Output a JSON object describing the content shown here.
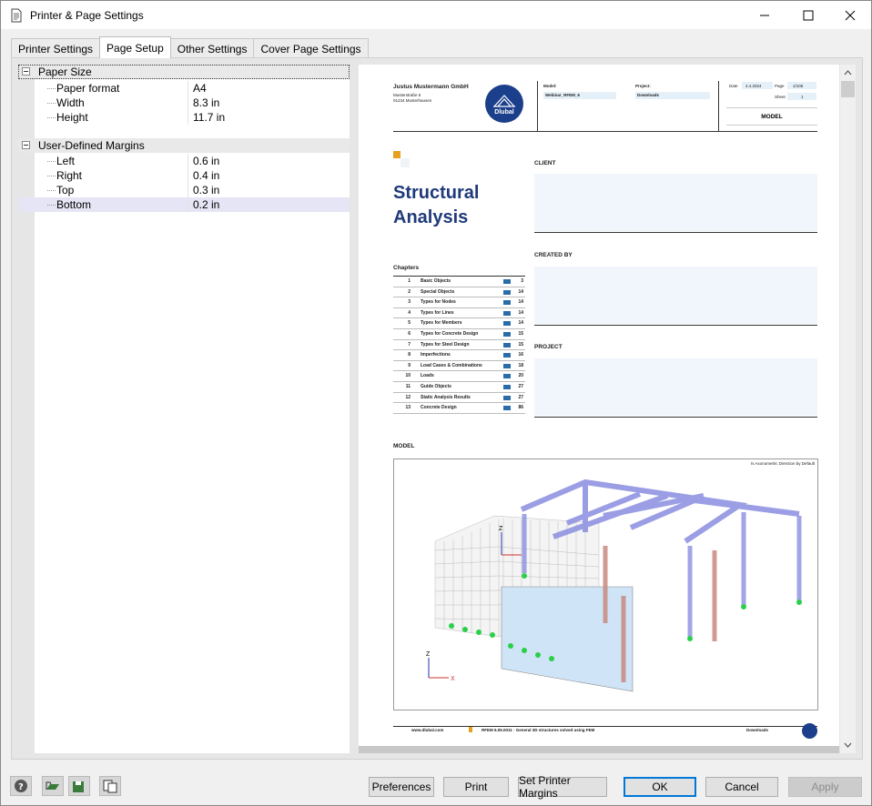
{
  "window": {
    "title": "Printer & Page Settings"
  },
  "tabs": [
    {
      "label": "Printer Settings"
    },
    {
      "label": "Page Setup"
    },
    {
      "label": "Other Settings"
    },
    {
      "label": "Cover Page Settings"
    }
  ],
  "tree": {
    "paper_size": {
      "label": "Paper Size",
      "rows": [
        {
          "label": "Paper format",
          "value": "A4"
        },
        {
          "label": "Width",
          "value": "8.3 in"
        },
        {
          "label": "Height",
          "value": "11.7 in"
        }
      ]
    },
    "margins": {
      "label": "User-Defined Margins",
      "rows": [
        {
          "label": "Left",
          "value": "0.6 in"
        },
        {
          "label": "Right",
          "value": "0.4 in"
        },
        {
          "label": "Top",
          "value": "0.3 in"
        },
        {
          "label": "Bottom",
          "value": "0.2 in"
        }
      ]
    }
  },
  "preview": {
    "company": "Justus Mustermann GmbH",
    "address1": "Musterstraße 5",
    "address2": "01234 Musterhausen",
    "logo_text": "Dlubal",
    "model_label": "Model:",
    "model_value": "Webinar_RFEM_6",
    "project_label": "Project:",
    "project_value": "Downloads",
    "date_label": "Date",
    "date_value": "4.4.2024",
    "page_label": "Page",
    "page_value": "1/106",
    "sheet_label": "Sheet",
    "sheet_value": "1",
    "model_box": "MODEL",
    "title_line1": "Structural",
    "title_line2": "Analysis",
    "client_label": "CLIENT",
    "created_by_label": "CREATED BY",
    "project_section_label": "PROJECT",
    "chapters_label": "Chapters",
    "chapters": [
      {
        "num": "1",
        "name": "Basic Objects",
        "page": "3"
      },
      {
        "num": "2",
        "name": "Special Objects",
        "page": "14"
      },
      {
        "num": "3",
        "name": "Types for Nodes",
        "page": "14"
      },
      {
        "num": "4",
        "name": "Types for Lines",
        "page": "14"
      },
      {
        "num": "5",
        "name": "Types for Members",
        "page": "14"
      },
      {
        "num": "6",
        "name": "Types for Concrete Design",
        "page": "15"
      },
      {
        "num": "7",
        "name": "Types for Steel Design",
        "page": "15"
      },
      {
        "num": "8",
        "name": "Imperfections",
        "page": "16"
      },
      {
        "num": "9",
        "name": "Load Cases & Combinations",
        "page": "18"
      },
      {
        "num": "10",
        "name": "Loads",
        "page": "20"
      },
      {
        "num": "11",
        "name": "Guide Objects",
        "page": "27"
      },
      {
        "num": "12",
        "name": "Static Analysis Results",
        "page": "27"
      },
      {
        "num": "13",
        "name": "Concrete Design",
        "page": "86"
      }
    ],
    "model_section_label": "MODEL",
    "model_image_caption": "Is Axonometric Direction by Default",
    "footer_url": "www.dlubal.com",
    "footer_software": "RFEM 6.05.0011 · General 3D structures solved using FEM",
    "footer_project": "Downloads"
  },
  "buttons": {
    "preferences": "Preferences",
    "print": "Print",
    "set_margins": "Set Printer Margins",
    "ok": "OK",
    "cancel": "Cancel",
    "apply": "Apply"
  },
  "colors": {
    "accent": "#0078d7",
    "title_blue": "#1f3a7a",
    "logo_blue": "#1c3f8c",
    "orange": "#e8a020"
  }
}
